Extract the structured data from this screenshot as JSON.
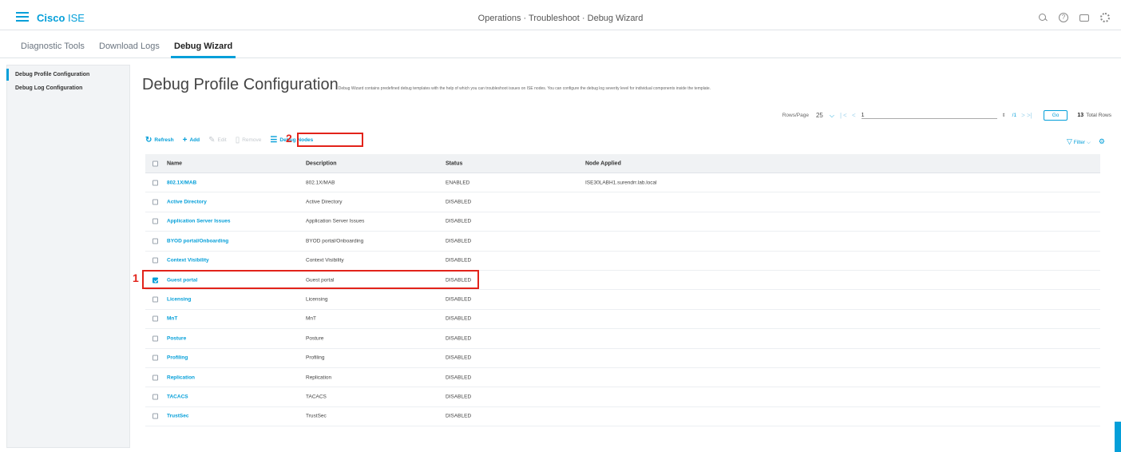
{
  "header": {
    "brand_bold": "Cisco",
    "brand_light": " ISE",
    "title": "Operations · Troubleshoot · Debug Wizard",
    "icons": [
      "search-icon",
      "help-icon",
      "notifications-icon",
      "gear-icon"
    ]
  },
  "tabs": [
    {
      "label": "Diagnostic Tools",
      "active": false
    },
    {
      "label": "Download Logs",
      "active": false
    },
    {
      "label": "Debug Wizard",
      "active": true
    }
  ],
  "sidebar": {
    "items": [
      {
        "label": "Debug Profile Configuration",
        "active": true
      },
      {
        "label": "Debug Log Configuration",
        "active": false
      }
    ]
  },
  "page": {
    "title": "Debug Profile Configuration",
    "description": "Debug Wizard contains predefined debug templates with the help of which you can troubleshoot issues on ISE nodes. You can configure the debug log severity level for individual components inside the template."
  },
  "pagination": {
    "rows_per_page_label": "Rows/Page",
    "rows_per_page_value": "25",
    "page_value": "1",
    "page_of": "/1",
    "go_label": "Go",
    "total_count": "13",
    "total_label": "Total Rows"
  },
  "toolbar": {
    "refresh": "Refresh",
    "add": "Add",
    "edit": "Edit",
    "remove": "Remove",
    "debug_nodes": "Debug Nodes",
    "filter": "Filter"
  },
  "annotations": {
    "callout_1": "1",
    "callout_2": "2"
  },
  "colors": {
    "accent": "#049fd9",
    "highlight": "#e2231a"
  },
  "table": {
    "columns": [
      "Name",
      "Description",
      "Status",
      "Node Applied"
    ],
    "rows": [
      {
        "name": "802.1X/MAB",
        "description": "802.1X/MAB",
        "status": "ENABLED",
        "node": "ISE30LABH1.surendrr.lab.local",
        "checked": false
      },
      {
        "name": "Active Directory",
        "description": "Active Directory",
        "status": "DISABLED",
        "node": "",
        "checked": false
      },
      {
        "name": "Application Server Issues",
        "description": "Application Server Issues",
        "status": "DISABLED",
        "node": "",
        "checked": false
      },
      {
        "name": "BYOD portal/Onboarding",
        "description": "BYOD portal/Onboarding",
        "status": "DISABLED",
        "node": "",
        "checked": false
      },
      {
        "name": "Context Visibility",
        "description": "Context Visibility",
        "status": "DISABLED",
        "node": "",
        "checked": false
      },
      {
        "name": "Guest portal",
        "description": "Guest portal",
        "status": "DISABLED",
        "node": "",
        "checked": true
      },
      {
        "name": "Licensing",
        "description": "Licensing",
        "status": "DISABLED",
        "node": "",
        "checked": false
      },
      {
        "name": "MnT",
        "description": "MnT",
        "status": "DISABLED",
        "node": "",
        "checked": false
      },
      {
        "name": "Posture",
        "description": "Posture",
        "status": "DISABLED",
        "node": "",
        "checked": false
      },
      {
        "name": "Profiling",
        "description": "Profiling",
        "status": "DISABLED",
        "node": "",
        "checked": false
      },
      {
        "name": "Replication",
        "description": "Replication",
        "status": "DISABLED",
        "node": "",
        "checked": false
      },
      {
        "name": "TACACS",
        "description": "TACACS",
        "status": "DISABLED",
        "node": "",
        "checked": false
      },
      {
        "name": "TrustSec",
        "description": "TrustSec",
        "status": "DISABLED",
        "node": "",
        "checked": false
      }
    ]
  }
}
